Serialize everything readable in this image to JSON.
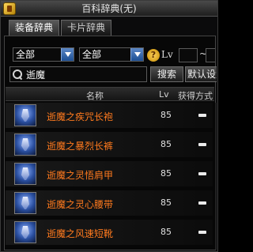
{
  "window": {
    "title": "百科辞典(无)"
  },
  "tabs": [
    {
      "label": "装备辞典",
      "active": true
    },
    {
      "label": "卡片辞典",
      "active": false
    }
  ],
  "filters": {
    "category1": "全部",
    "category2": "全部",
    "lv_label": "Lv",
    "lv_separator": "~",
    "lv_min": "",
    "lv_max": ""
  },
  "search": {
    "value": "逝魔",
    "button_label": "搜索",
    "reset_label": "默认设置"
  },
  "table": {
    "headers": {
      "name": "名称",
      "lv": "Lv",
      "acquire": "获得方式"
    },
    "rows": [
      {
        "name": "逝魔之疾咒长袍",
        "lv": "85",
        "icon": "robe-icon"
      },
      {
        "name": "逝魔之暴烈长裤",
        "lv": "85",
        "icon": "pants-icon"
      },
      {
        "name": "逝魔之灵悟肩甲",
        "lv": "85",
        "icon": "shoulder-armor-icon"
      },
      {
        "name": "逝魔之灵心腰带",
        "lv": "85",
        "icon": "belt-icon"
      },
      {
        "name": "逝魔之风速短靴",
        "lv": "85",
        "icon": "boots-icon"
      }
    ]
  },
  "colors": {
    "item_name": "#ff7a1e",
    "accent_blue": "#2f6cc0"
  }
}
